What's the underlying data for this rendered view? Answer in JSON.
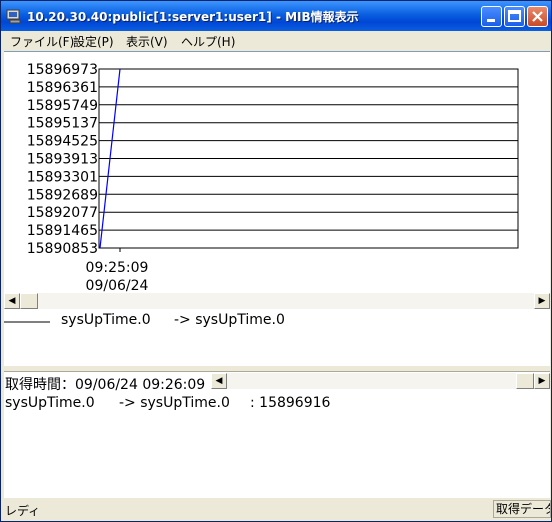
{
  "window": {
    "title": "10.20.30.40:public[1:server1:user1] - MIB情報表示"
  },
  "menu": {
    "items": [
      "ファイル(F)",
      "設定(P)",
      "表示(V)",
      "ヘルプ(H)"
    ]
  },
  "chart_data": {
    "type": "line",
    "y_ticks": [
      "15896973",
      "15896361",
      "15895749",
      "15895137",
      "15894525",
      "15893913",
      "15893301",
      "15892689",
      "15892077",
      "15891465",
      "15890853"
    ],
    "ylim": [
      15890853,
      15896973
    ],
    "x_tick_time": "09:25:09",
    "x_tick_date": "09/06/24",
    "series": [
      {
        "name": "sysUpTime.0",
        "color": "#0000ff",
        "x": [
          0,
          1
        ],
        "values": [
          15890853,
          15896973
        ]
      }
    ]
  },
  "legend": {
    "series_name": "sysUpTime.0",
    "arrow_label": "-> sysUpTime.0"
  },
  "log": {
    "header": "取得時間：09/06/24 09:26:09",
    "row": {
      "name": "sysUpTime.0",
      "arrow": "-> sysUpTime.0",
      "value": ": 15896916"
    }
  },
  "status": {
    "left": "レディ",
    "right": "取得データ"
  },
  "colors": {
    "title_bar": "#0a5fe0",
    "series_line": "#0000ff"
  }
}
